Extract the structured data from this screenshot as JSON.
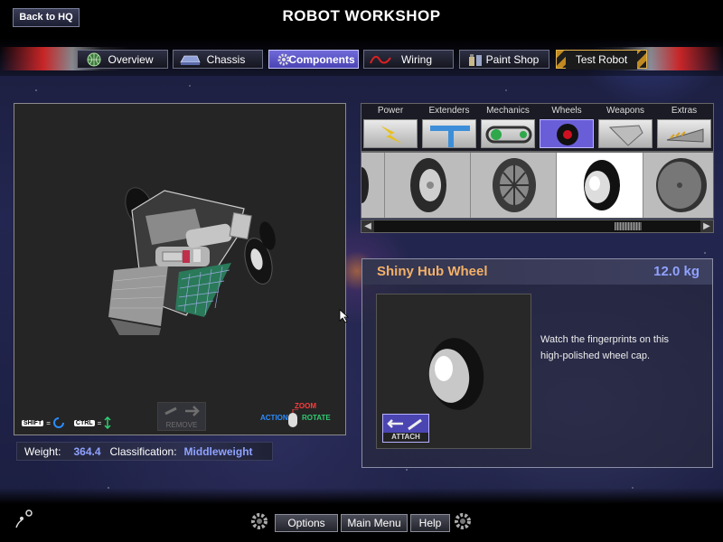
{
  "header": {
    "back_label": "Back to HQ",
    "title": "ROBOT WORKSHOP"
  },
  "tabs": [
    {
      "label": "Overview",
      "icon": "globe-icon"
    },
    {
      "label": "Chassis",
      "icon": "chassis-icon"
    },
    {
      "label": "Components",
      "icon": "gear-icon",
      "active": true
    },
    {
      "label": "Wiring",
      "icon": "wire-icon"
    },
    {
      "label": "Paint Shop",
      "icon": "paint-can-icon"
    },
    {
      "label": "Test Robot",
      "icon": "hazard-stripes"
    }
  ],
  "viewport": {
    "shift_key": "SHIFT",
    "ctrl_key": "CTRL",
    "remove_label": "REMOVE",
    "zoom_label": "ZOOM",
    "action_label": "ACTION",
    "rotate_label": "ROTATE"
  },
  "stats": {
    "weight_label": "Weight:",
    "weight_value": "364.4",
    "class_label": "Classification:",
    "class_value": "Middleweight"
  },
  "categories": [
    {
      "label": "Power",
      "icon": "lightning-icon"
    },
    {
      "label": "Extenders",
      "icon": "extender-icon"
    },
    {
      "label": "Mechanics",
      "icon": "chain-icon"
    },
    {
      "label": "Wheels",
      "icon": "wheel-icon",
      "active": true
    },
    {
      "label": "Weapons",
      "icon": "blade-icon"
    },
    {
      "label": "Extras",
      "icon": "wedge-icon"
    }
  ],
  "detail": {
    "name": "Shiny Hub Wheel",
    "weight": "12.0 kg",
    "description": "Watch the fingerprints on this high-polished wheel cap.",
    "attach_label": "ATTACH"
  },
  "footer": {
    "options_label": "Options",
    "main_menu_label": "Main Menu",
    "help_label": "Help"
  },
  "colors": {
    "accent": "#6a5ed8",
    "part_name": "#f3b068",
    "value_blue": "#8fa2ff"
  }
}
